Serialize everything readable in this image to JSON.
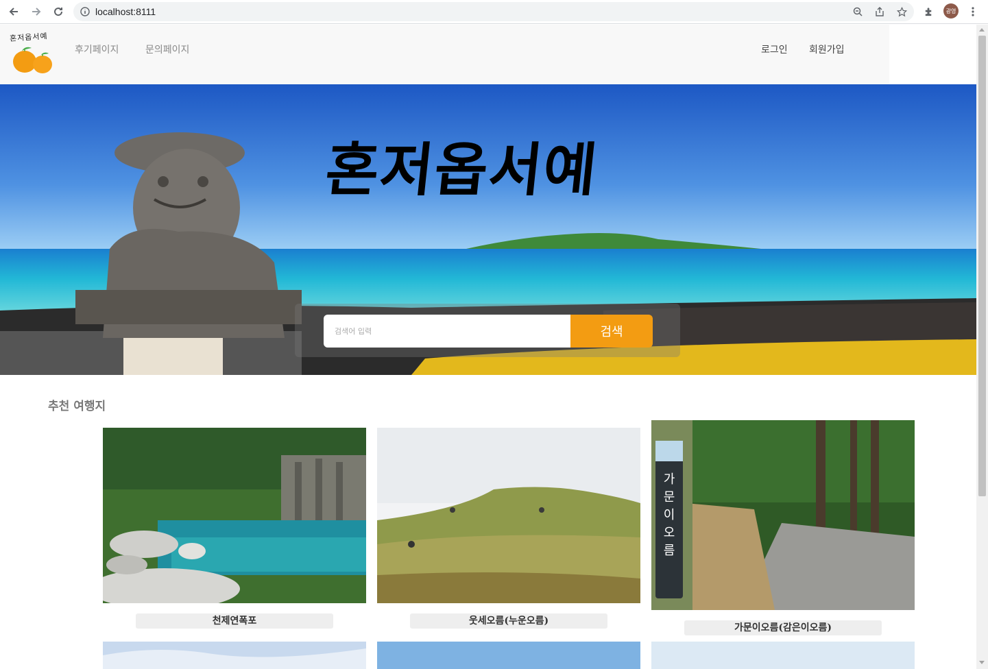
{
  "browser": {
    "url": "localhost:8111",
    "profile_initials": "광영",
    "icons": [
      "back-arrow-icon",
      "forward-arrow-icon",
      "reload-icon",
      "info-icon",
      "zoom-icon",
      "share-icon",
      "star-icon",
      "extensions-icon",
      "menu-dots-icon"
    ]
  },
  "header": {
    "logo_text": "혼저옵서예",
    "nav_left": [
      "후기페이지",
      "문의페이지"
    ],
    "nav_right": [
      "로그인",
      "회원가입"
    ]
  },
  "hero": {
    "title": "혼저옵서예",
    "search_placeholder": "검색어 입력",
    "search_button": "검색"
  },
  "recommend": {
    "title": "추천 여행지",
    "items": [
      {
        "name": "천제연폭포"
      },
      {
        "name": "웃세오름(누운오름)"
      },
      {
        "name": "가문이오름(감은이오름)"
      }
    ]
  },
  "colors": {
    "accent": "#f39c12",
    "header_bg": "#f8f8f8"
  }
}
